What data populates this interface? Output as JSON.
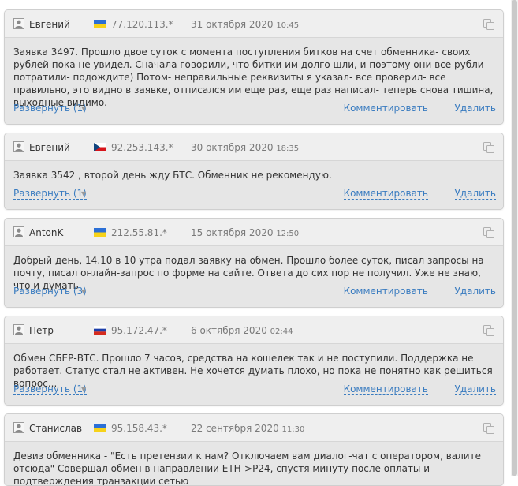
{
  "reviews": [
    {
      "author": "Евгений",
      "flag": "ua",
      "ip": "77.120.113.*",
      "date": "31 октября 2020",
      "time": "10:45",
      "text": "Заявка 3497. Прошло двое суток с момента поступления битков на счет обменника- своих рублей пока не увидел. Сначала говорили, что битки им долго шли, и поэтому они все рубли потратили- подождите) Потом- неправильные реквизиты я указал- все проверил- все правильно, это видно в заявке, отписался им еще раз, еще раз написал- теперь снова тишина, выходные видимо.",
      "expand_label": "Развернуть (1)",
      "comment_label": "Комментировать",
      "delete_label": "Удалить"
    },
    {
      "author": "Евгений",
      "flag": "cz",
      "ip": "92.253.143.*",
      "date": "30 октября 2020",
      "time": "18:35",
      "text": "Заявка 3542 , второй день жду БТС. Обменник не рекомендую.",
      "expand_label": "Развернуть (1)",
      "comment_label": "Комментировать",
      "delete_label": "Удалить"
    },
    {
      "author": "AntonK",
      "flag": "ua",
      "ip": "212.55.81.*",
      "date": "15 октября 2020",
      "time": "12:50",
      "text": "Добрый день, 14.10 в 10 утра подал заявку на обмен. Прошло более суток, писал запросы на почту, писал онлайн-запрос по форме на сайте. Ответа до сих пор не получил. Уже не знаю, что и думать",
      "expand_label": "Развернуть (3)",
      "comment_label": "Комментировать",
      "delete_label": "Удалить"
    },
    {
      "author": "Петр",
      "flag": "ru",
      "ip": "95.172.47.*",
      "date": "6 октября 2020",
      "time": "02:44",
      "text": "Обмен СБЕР-ВТС. Прошло 7 часов, средства на кошелек так и не поступили. Поддержка не работает. Статус стал не активен. Не хочется думать плохо, но пока не понятно как решиться вопрос...",
      "expand_label": "Развернуть (1)",
      "comment_label": "Комментировать",
      "delete_label": "Удалить"
    },
    {
      "author": "Станислав",
      "flag": "ua",
      "ip": "95.158.43.*",
      "date": "22 сентября 2020",
      "time": "11:30",
      "text": "Девиз обменника - \"Есть претензии к нам? Отключаем вам диалог-чат с оператором, валите отсюда\" Совершал обмен в направлении ETH->P24, спустя минуту после оплаты и подтверждения транзакции сетью",
      "expand_label": "",
      "comment_label": "",
      "delete_label": ""
    }
  ],
  "icons": {
    "avatar": "user-icon",
    "copy": "copy-icon",
    "caret": "caret-down-icon"
  },
  "colors": {
    "link": "#3a7cc0",
    "card_bg": "#e6e6e6",
    "header_bg": "#efefef"
  }
}
